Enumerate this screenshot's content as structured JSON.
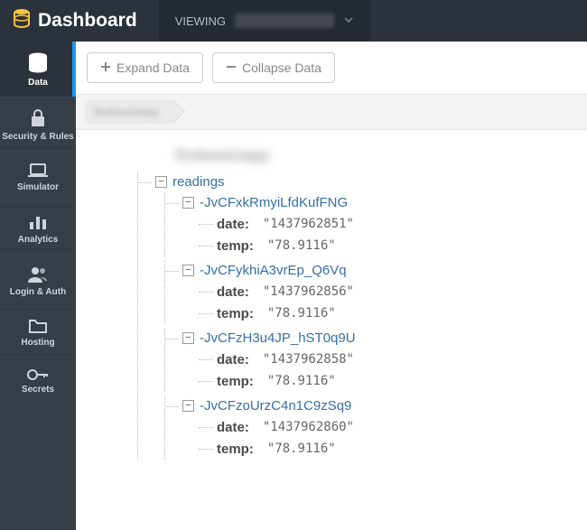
{
  "header": {
    "title": "Dashboard",
    "viewing_label": "VIEWING",
    "viewing_value": "firebase-app-7b4e"
  },
  "sidebar": {
    "items": [
      {
        "label": "Data"
      },
      {
        "label": "Security & Rules"
      },
      {
        "label": "Simulator"
      },
      {
        "label": "Analytics"
      },
      {
        "label": "Login & Auth"
      },
      {
        "label": "Hosting"
      },
      {
        "label": "Secrets"
      }
    ]
  },
  "toolbar": {
    "expand_label": "Expand Data",
    "collapse_label": "Collapse Data"
  },
  "breadcrumb": {
    "root": "firebaseioapp"
  },
  "tree": {
    "root_label": "firebaseioapp",
    "readings_key": "readings",
    "entries": [
      {
        "id": "-JvCFxkRmyiLfdKufFNG",
        "date": "1437962851",
        "temp": "78.9116"
      },
      {
        "id": "-JvCFykhiA3vrEp_Q6Vq",
        "date": "1437962856",
        "temp": "78.9116"
      },
      {
        "id": "-JvCFzH3u4JP_hST0q9U",
        "date": "1437962858",
        "temp": "78.9116"
      },
      {
        "id": "-JvCFzoUrzC4n1C9zSq9",
        "date": "1437962860",
        "temp": "78.9116"
      }
    ],
    "field_labels": {
      "date": "date",
      "temp": "temp"
    }
  }
}
